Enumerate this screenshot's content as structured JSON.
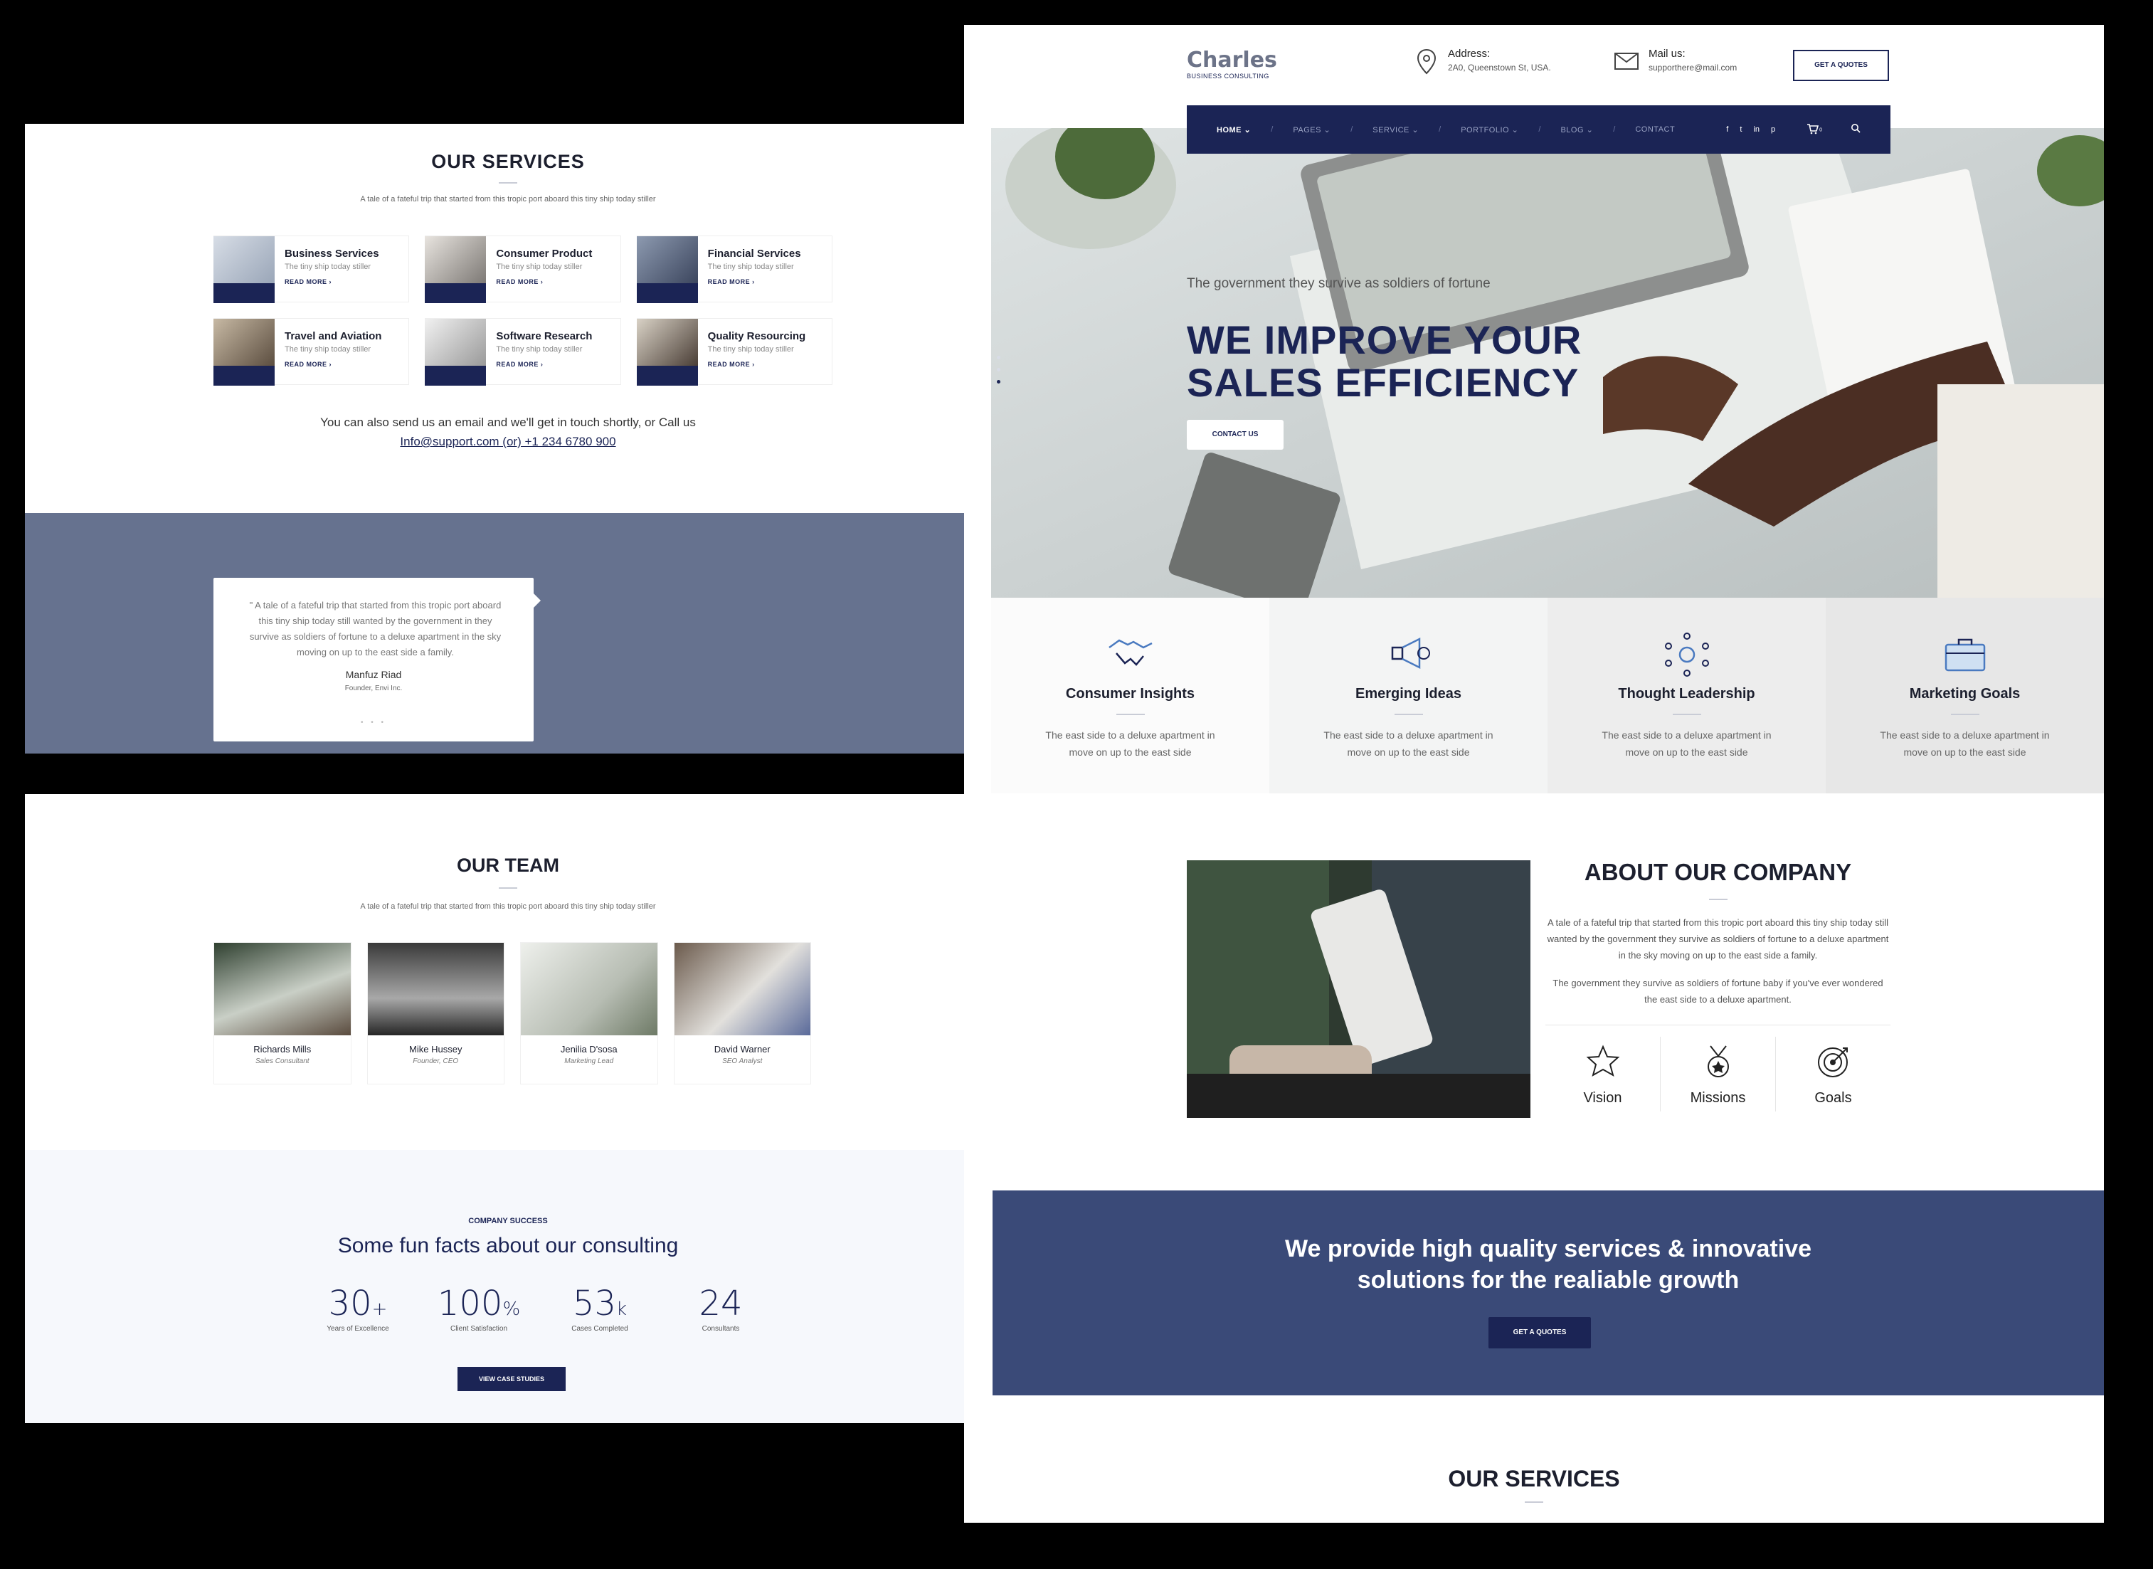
{
  "services_section": {
    "title": "OUR SERVICES",
    "subtitle": "A tale of a fateful trip that started from this tropic port aboard this tiny ship today stiller",
    "items": [
      {
        "name": "Business Services",
        "desc": "The tiny ship today stiller",
        "link": "READ MORE ›"
      },
      {
        "name": "Consumer Product",
        "desc": "The tiny ship today stiller",
        "link": "READ MORE ›"
      },
      {
        "name": "Financial Services",
        "desc": "The tiny ship today stiller",
        "link": "READ MORE ›"
      },
      {
        "name": "Travel and Aviation",
        "desc": "The tiny ship today stiller",
        "link": "READ MORE ›"
      },
      {
        "name": "Software Research",
        "desc": "The tiny ship today stiller",
        "link": "READ MORE ›"
      },
      {
        "name": "Quality Resourcing",
        "desc": "The tiny ship today stiller",
        "link": "READ MORE ›"
      }
    ],
    "contact_line": "You can also send us an email and we'll get in touch shortly, or Call us",
    "contact_link": "Info@support.com (or) +1 234 6780 900"
  },
  "testimonial": {
    "quote": "\" A tale of a fateful trip that started from this tropic port aboard this tiny ship today still wanted by the government in they survive as soldiers of fortune to a deluxe apartment in the sky moving on up to the east side a family.",
    "name": "Manfuz Riad",
    "role": "Founder, Envi Inc.",
    "dots": "• • •"
  },
  "team": {
    "title": "OUR TEAM",
    "subtitle": "A tale of a fateful trip that started from this tropic port aboard this tiny ship today stiller",
    "members": [
      {
        "name": "Richards Mills",
        "role": "Sales Consultant"
      },
      {
        "name": "Mike Hussey",
        "role": "Founder, CEO"
      },
      {
        "name": "Jenilia D'sosa",
        "role": "Marketing Lead"
      },
      {
        "name": "David Warner",
        "role": "SEO Analyst"
      }
    ]
  },
  "facts": {
    "eyebrow": "COMPANY SUCCESS",
    "title": "Some fun facts about our consulting",
    "stats": [
      {
        "num": "30",
        "suffix": "+",
        "label": "Years of Excellence"
      },
      {
        "num": "100",
        "suffix": "%",
        "label": "Client Satisfaction"
      },
      {
        "num": "53",
        "suffix": "k",
        "label": "Cases Completed"
      },
      {
        "num": "24",
        "suffix": "",
        "label": "Consultants"
      }
    ],
    "button": "VIEW CASE STUDIES"
  },
  "header": {
    "brand": "Charles",
    "tagline": "BUSINESS CONSULTING",
    "address_label": "Address:",
    "address_value": "2A0, Queenstown St, USA.",
    "mail_label": "Mail us:",
    "mail_value": "supporthere@mail.com",
    "quote_button": "GET A QUOTES"
  },
  "nav": {
    "items": [
      "HOME",
      "PAGES",
      "SERVICE",
      "PORTFOLIO",
      "BLOG",
      "CONTACT"
    ],
    "social": [
      "f",
      "t",
      "in",
      "p"
    ],
    "cart_count": "0"
  },
  "hero": {
    "kicker": "The government they survive as soldiers of fortune",
    "headline_1": "WE IMPROVE YOUR",
    "headline_2": "SALES EFFICIENCY",
    "cta": "CONTACT US"
  },
  "features": [
    {
      "title": "Consumer Insights",
      "desc": "The east side to a deluxe apartment in move on up to the east side",
      "icon": "handshake-icon"
    },
    {
      "title": "Emerging Ideas",
      "desc": "The east side to a deluxe apartment in move on up to the east side",
      "icon": "megaphone-icon"
    },
    {
      "title": "Thought Leadership",
      "desc": "The east side to a deluxe apartment in move on up to the east side",
      "icon": "network-icon"
    },
    {
      "title": "Marketing Goals",
      "desc": "The east side to a deluxe apartment in move on up to the east side",
      "icon": "briefcase-icon"
    }
  ],
  "about": {
    "title": "ABOUT OUR COMPANY",
    "p1": "A tale of a fateful trip that started from this tropic port aboard this tiny ship today still wanted by the government they survive as soldiers of fortune to a deluxe apartment in the sky moving on up to the east side a family.",
    "p2": "The government they survive as soldiers of fortune baby if you've ever wondered the east side to a deluxe apartment.",
    "pillars": [
      "Vision",
      "Missions",
      "Goals"
    ]
  },
  "cta_band": {
    "line1": "We provide high quality services & innovative",
    "line2": "solutions for the realiable growth",
    "button": "GET A QUOTES"
  },
  "bottom_services_title": "OUR SERVICES",
  "colors": {
    "navy": "#1b2455",
    "band": "#3a4a78",
    "testimonial_band": "#66728f"
  }
}
